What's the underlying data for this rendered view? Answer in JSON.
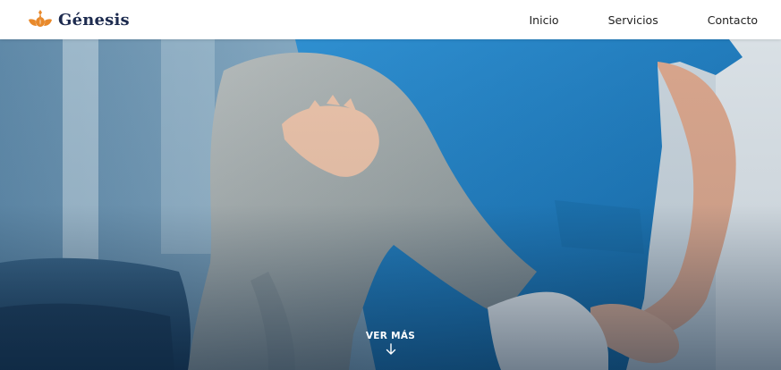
{
  "header": {
    "brand": {
      "name": "Génesis",
      "logo_icon": "lotus-logo-icon",
      "accent_color": "#e8892b",
      "name_color": "#1d2b4f"
    },
    "nav": {
      "items": [
        {
          "label": "Inicio"
        },
        {
          "label": "Servicios"
        },
        {
          "label": "Contacto"
        }
      ]
    }
  },
  "hero": {
    "image_subject": "physiotherapist-knee-exercise-photo",
    "cta": {
      "label": "VER MÁS",
      "icon": "arrow-down-icon"
    }
  }
}
